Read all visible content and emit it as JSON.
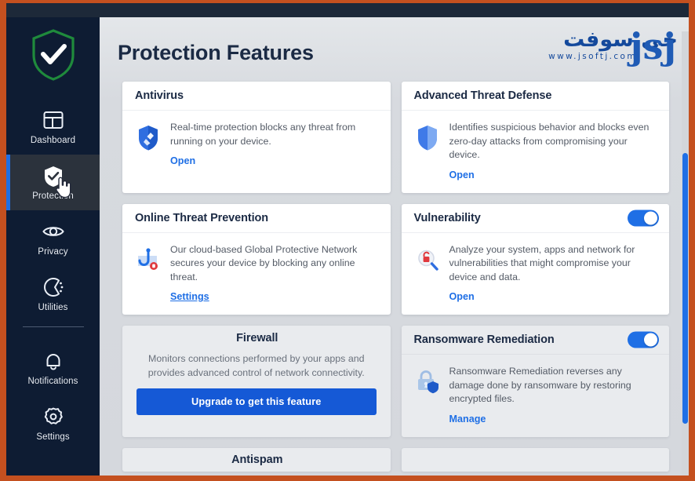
{
  "window": {
    "accent_orange": "#c4501f",
    "titlebar_color": "#1d2939"
  },
  "sidebar": {
    "logo_icon": "green-shield-check-icon",
    "items": [
      {
        "label": "Dashboard",
        "icon": "dashboard-icon",
        "active": false
      },
      {
        "label": "Protection",
        "icon": "shield-check-icon",
        "active": true
      },
      {
        "label": "Privacy",
        "icon": "eye-icon",
        "active": false
      },
      {
        "label": "Utilities",
        "icon": "utilities-icon",
        "active": false
      }
    ],
    "bottom_items": [
      {
        "label": "Notifications",
        "icon": "bell-icon"
      },
      {
        "label": "Settings",
        "icon": "gear-icon"
      }
    ],
    "cursor": "hand-pointer-cursor"
  },
  "header": {
    "title": "Protection Features",
    "brand": {
      "arabic": "جی سوفت",
      "mark": "jsj",
      "url": "www.jsoftj.com",
      "color": "#14499c"
    }
  },
  "cards": [
    {
      "title": "Antivirus",
      "icon": "shield-brush-icon",
      "description": "Real-time protection blocks any threat from running on your device.",
      "link": "Open",
      "link_underlined": false,
      "toggle": null,
      "dim": false
    },
    {
      "title": "Advanced Threat Defense",
      "icon": "shield-icon",
      "description": "Identifies suspicious behavior and blocks even zero-day attacks from compromising your device.",
      "link": "Open",
      "link_underlined": false,
      "toggle": null,
      "dim": false
    },
    {
      "title": "Online Threat Prevention",
      "icon": "fishing-hook-icon",
      "description": "Our cloud-based Global Protective Network secures your device by blocking any online threat.",
      "link": "Settings",
      "link_underlined": true,
      "toggle": null,
      "dim": false
    },
    {
      "title": "Vulnerability",
      "icon": "magnifier-lock-icon",
      "description": "Analyze your system, apps and network for vulnerabilities that might compromise your device and data.",
      "link": "Open",
      "link_underlined": false,
      "toggle": "on",
      "dim": false
    }
  ],
  "firewall": {
    "title": "Firewall",
    "description": "Monitors connections performed by your apps and provides advanced control of network connectivity.",
    "button": "Upgrade to get this feature",
    "button_color": "#1559d6"
  },
  "ransomware": {
    "title": "Ransomware Remediation",
    "icon": "padlock-shield-icon",
    "description": "Ransomware Remediation reverses any damage done by ransomware by restoring encrypted files.",
    "link": "Manage",
    "toggle": "on"
  },
  "antispam": {
    "title": "Antispam"
  },
  "scrollbar": {
    "color": "#1f6fe5"
  }
}
